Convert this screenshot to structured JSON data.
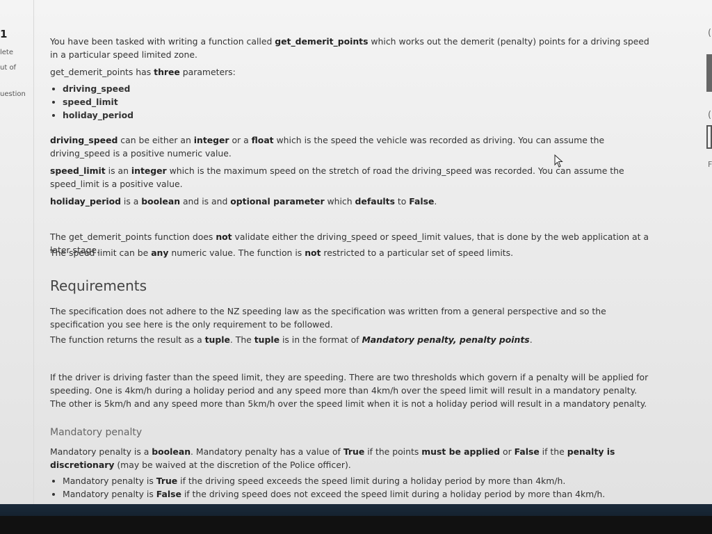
{
  "left_rail": {
    "number": "1",
    "labels": [
      "lete",
      "ut of",
      "uestion"
    ]
  },
  "intro": {
    "line1_pre": "You have been tasked with writing a function called ",
    "func_name": "get_demerit_points",
    "line1_post": " which works out the demerit (penalty) points for a driving speed in a particular speed limited zone.",
    "params_pre": "get_demerit_points has ",
    "params_bold": "three",
    "params_post": " parameters:",
    "params": [
      "driving_speed",
      "speed_limit",
      "holiday_period"
    ]
  },
  "param_desc": {
    "driving_speed": {
      "name": "driving_speed",
      "t1": " can be either an ",
      "b1": "integer",
      "t2": " or a ",
      "b2": "float",
      "t3": " which is the speed the vehicle was recorded as driving.  You can assume the driving_speed is a positive numeric value."
    },
    "speed_limit": {
      "name": "speed_limit",
      "t1": " is an ",
      "b1": "integer",
      "t2": " which is the maximum speed on the stretch of road the driving_speed was recorded.  You can assume the speed_limit is a positive value."
    },
    "holiday_period": {
      "name": "holiday_period",
      "t1": " is a ",
      "b1": "boolean",
      "t2": " and is and ",
      "b2": "optional parameter",
      "t3": " which ",
      "b3": "defaults",
      "t4": " to ",
      "b4": "False",
      "t5": "."
    }
  },
  "notes": {
    "n1_pre": "The get_demerit_points function does ",
    "n1_bold": "not",
    "n1_post": " validate either the driving_speed or speed_limit values, that is done by the web application at a later stage.",
    "n2_pre": "The speed limit can be ",
    "n2_bold1": "any",
    "n2_mid": " numeric value. The function is ",
    "n2_bold2": "not",
    "n2_post": " restricted to a particular set of speed limits."
  },
  "requirements": {
    "heading": "Requirements",
    "p1": "The specification does not adhere to the NZ speeding law as the specification was written from a general perspective and so the specification you see here is the only requirement to be followed.",
    "p2_pre": "The function returns the result as a ",
    "p2_b1": "tuple",
    "p2_mid": ".  The ",
    "p2_b2": "tuple",
    "p2_mid2": " is in the format of ",
    "p2_b3": "Mandatory penalty, penalty points",
    "p2_post": ".",
    "p3": "If the driver is driving faster than the speed limit, they are speeding.  There are two thresholds which govern if a penalty will be applied for speeding.  One is 4km/h during a holiday period and any speed more than 4km/h over the speed limit will result in a mandatory penalty.  The other is 5km/h and any speed more than 5km/h over the speed limit when it is not a holiday period will result in a mandatory penalty."
  },
  "mandatory": {
    "heading": "Mandatory penalty",
    "p_pre": "Mandatory penalty is a ",
    "p_b1": "boolean",
    "p_t1": ".  Mandatory penalty has a value of ",
    "p_b2": "True",
    "p_t2": " if the points ",
    "p_b3": "must be applied",
    "p_t3": " or ",
    "p_b4": "False",
    "p_t4": " if the ",
    "p_b5": "penalty is discretionary",
    "p_t5": " (may be waived at the discretion of the Police officer).",
    "b1_pre": "Mandatory penalty is ",
    "b1_bold": "True",
    "b1_post": " if the driving speed exceeds the speed limit during a holiday period by more than 4km/h.",
    "b2_pre": "Mandatory penalty is ",
    "b2_bold": "False",
    "b2_post": " if the driving speed does not exceed the speed limit during a holiday period by more than 4km/h."
  },
  "right_rail": {
    "fragments": [
      "(",
      "(",
      "(",
      "Fi"
    ]
  }
}
